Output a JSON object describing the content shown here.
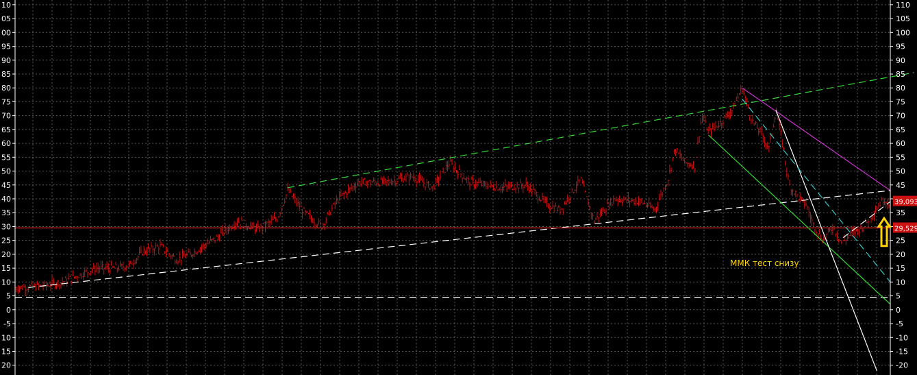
{
  "chart_data": {
    "type": "bar",
    "subtype": "ohlc",
    "series_color": "#cc1111",
    "background": "#000000",
    "grid": true,
    "ylim": [
      -22,
      112
    ],
    "y_ticks": [
      110,
      105,
      100,
      95,
      90,
      85,
      80,
      75,
      70,
      65,
      60,
      55,
      50,
      45,
      40,
      35,
      30,
      25,
      20,
      15,
      10,
      5,
      0,
      -5,
      -10,
      -15,
      -20
    ],
    "y_tick_labels_left": [
      "10",
      "05",
      "00",
      "95",
      "90",
      "85",
      "80",
      "75",
      "70",
      "65",
      "60",
      "55",
      "50",
      "45",
      "40",
      "35",
      "30",
      "25",
      "20",
      "15",
      "10",
      "5",
      "0",
      "-5",
      "10",
      "15",
      "20"
    ],
    "y_tick_labels_right": [
      "110",
      "105",
      "100",
      "95",
      "90",
      "85",
      "80",
      "75",
      "70",
      "65",
      "60",
      "55",
      "50",
      "45",
      "40",
      "35",
      "30",
      "25",
      "20",
      "15",
      "10",
      "5",
      "0",
      "-5",
      "-10",
      "-15",
      "-20"
    ],
    "price_path": [
      [
        0,
        8
      ],
      [
        40,
        8.5
      ],
      [
        70,
        10
      ],
      [
        90,
        12
      ],
      [
        120,
        15
      ],
      [
        150,
        15
      ],
      [
        170,
        16
      ],
      [
        190,
        21
      ],
      [
        215,
        23
      ],
      [
        240,
        18
      ],
      [
        260,
        20
      ],
      [
        300,
        26
      ],
      [
        330,
        32
      ],
      [
        360,
        29
      ],
      [
        390,
        33
      ],
      [
        405,
        43
      ],
      [
        430,
        35
      ],
      [
        455,
        30
      ],
      [
        480,
        40
      ],
      [
        510,
        46
      ],
      [
        550,
        46
      ],
      [
        590,
        48
      ],
      [
        620,
        44
      ],
      [
        645,
        53
      ],
      [
        675,
        46
      ],
      [
        720,
        44
      ],
      [
        760,
        45
      ],
      [
        790,
        38
      ],
      [
        810,
        36
      ],
      [
        840,
        47
      ],
      [
        860,
        32
      ],
      [
        890,
        40
      ],
      [
        930,
        39
      ],
      [
        950,
        36
      ],
      [
        970,
        47
      ],
      [
        980,
        58
      ],
      [
        995,
        53
      ],
      [
        1010,
        52
      ],
      [
        1020,
        70
      ],
      [
        1030,
        64
      ],
      [
        1050,
        68
      ],
      [
        1065,
        72
      ],
      [
        1080,
        80
      ],
      [
        1095,
        68
      ],
      [
        1110,
        63
      ],
      [
        1120,
        58
      ],
      [
        1130,
        72
      ],
      [
        1140,
        60
      ],
      [
        1150,
        45
      ],
      [
        1165,
        40
      ],
      [
        1175,
        38
      ],
      [
        1185,
        31
      ],
      [
        1200,
        25
      ],
      [
        1215,
        30
      ],
      [
        1228,
        24
      ],
      [
        1240,
        27
      ],
      [
        1260,
        30
      ],
      [
        1275,
        35
      ],
      [
        1290,
        40
      ],
      [
        1300,
        38
      ]
    ],
    "trendlines": [
      {
        "color": "#33dd33",
        "dash": true,
        "from": [
          405,
          44
        ],
        "to": [
          1335,
          85.5
        ]
      },
      {
        "color": "#ffffff",
        "dash": true,
        "from": [
          20,
          8
        ],
        "to": [
          1300,
          43
        ]
      },
      {
        "color": "#ffffff",
        "dash": true,
        "from": [
          0,
          4.5
        ],
        "to": [
          1300,
          4.5
        ]
      },
      {
        "color": "#ee2222",
        "dash": false,
        "from": [
          0,
          29.5
        ],
        "to": [
          1300,
          29.5
        ]
      },
      {
        "color": "#cc33cc",
        "dash": false,
        "from": [
          1080,
          80
        ],
        "to": [
          1300,
          43
        ]
      },
      {
        "color": "#33dd33",
        "dash": false,
        "from": [
          1030,
          63
        ],
        "to": [
          1300,
          2
        ]
      },
      {
        "color": "#ffffff",
        "dash": false,
        "from": [
          1130,
          72
        ],
        "to": [
          1280,
          -22
        ]
      },
      {
        "color": "#33cccc",
        "dash": true,
        "from": [
          1080,
          76
        ],
        "to": [
          1300,
          10
        ]
      },
      {
        "color": "#ffffff",
        "dash": true,
        "from": [
          1230,
          26
        ],
        "to": [
          1300,
          39
        ]
      }
    ],
    "price_labels": [
      {
        "text": "39,093",
        "value": 39.1,
        "bg": "#cc1111"
      },
      {
        "text": "29,529",
        "value": 29.5,
        "bg": "#cc1111"
      }
    ],
    "annotation": "ММК  тест снизу",
    "arrow_color": "#ffd400"
  }
}
